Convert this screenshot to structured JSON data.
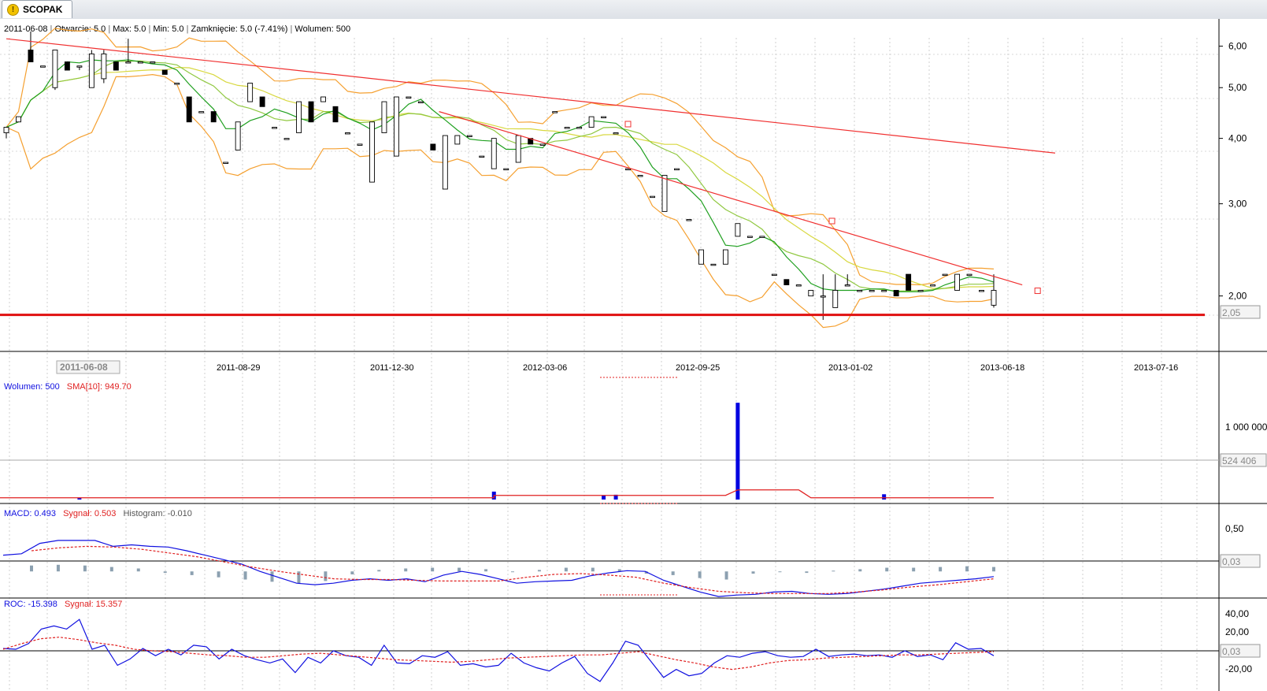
{
  "tab": {
    "label": "SCOPAK",
    "icon": "warning-icon"
  },
  "price_info": {
    "date": "2011-06-08",
    "open": "Otwarcie: 5.0",
    "max": "Max: 5.0",
    "min": "Min: 5.0",
    "close": "Zamknięcie: 5.0 (-7.41%)",
    "volume": "Wolumen: 500"
  },
  "volume_info": {
    "volume": "Wolumen: 500",
    "sma": "SMA[10]: 949.70"
  },
  "macd_info": {
    "macd": "MACD: 0.493",
    "signal": "Sygnał: 0.503",
    "hist": "Histogram: -0.010"
  },
  "roc_info": {
    "roc": "ROC: -15.398",
    "signal": "Sygnał: 15.357"
  },
  "x_labels": [
    "2011-06-08",
    "2011-08-29",
    "2011-12-30",
    "2012-03-06",
    "2012-09-25",
    "2013-01-02",
    "2013-06-18",
    "2013-07-16"
  ],
  "price_marker": "2,05",
  "volume_marker": "524 406",
  "macd_marker": "0,03",
  "roc_marker": "0,03",
  "colors": {
    "up": "#ffffff",
    "down": "#000000",
    "bollinger": "#f5a030",
    "ma_short": "#20a020",
    "ma_mid": "#90c840",
    "ma_long": "#d8d840",
    "trend": "#f03030",
    "support": "#e01010",
    "volume": "#0000e0",
    "macd": "#1010e0",
    "signal": "#e02020",
    "hist": "#8ca0b0"
  },
  "chart_data": [
    {
      "type": "candlestick",
      "title": "SCOPAK",
      "y_ticks": [
        "6,00",
        "5,00",
        "4,00",
        "3,00",
        "2,00"
      ],
      "ylim": [
        1.6,
        6.4
      ],
      "scale": "log",
      "candles": [
        [
          4.1,
          4.2,
          4.2,
          4.0
        ],
        [
          4.3,
          4.4,
          4.4,
          4.3
        ],
        [
          5.9,
          5.6,
          6.4,
          5.6
        ],
        [
          5.5,
          5.5,
          5.5,
          5.5
        ],
        [
          5.0,
          5.9,
          5.9,
          4.95
        ],
        [
          5.6,
          5.4,
          5.6,
          5.4
        ],
        [
          5.5,
          5.5,
          5.5,
          5.4
        ],
        [
          5.0,
          5.8,
          5.9,
          5.0
        ],
        [
          5.2,
          5.8,
          5.9,
          5.1
        ],
        [
          5.6,
          5.4,
          5.6,
          5.4
        ],
        [
          5.6,
          5.6,
          6.2,
          5.6
        ],
        [
          5.6,
          5.6,
          5.6,
          5.6
        ],
        [
          5.6,
          5.6,
          5.6,
          5.6
        ],
        [
          5.4,
          5.3,
          5.4,
          5.3
        ],
        [
          5.1,
          5.1,
          5.1,
          5.1
        ],
        [
          4.8,
          4.3,
          4.8,
          4.3
        ],
        [
          4.5,
          4.5,
          4.5,
          4.5
        ],
        [
          4.5,
          4.3,
          4.5,
          4.3
        ],
        [
          3.6,
          3.6,
          3.6,
          3.6
        ],
        [
          3.8,
          4.3,
          4.3,
          3.8
        ],
        [
          4.7,
          5.1,
          5.1,
          4.7
        ],
        [
          4.8,
          4.6,
          4.8,
          4.6
        ],
        [
          4.2,
          4.2,
          4.2,
          4.2
        ],
        [
          4.0,
          4.0,
          4.0,
          4.0
        ],
        [
          4.1,
          4.7,
          4.7,
          4.1
        ],
        [
          4.7,
          4.3,
          4.7,
          4.3
        ],
        [
          4.7,
          4.8,
          4.8,
          4.7
        ],
        [
          4.6,
          4.3,
          4.6,
          4.3
        ],
        [
          4.1,
          4.1,
          4.1,
          4.1
        ],
        [
          3.9,
          3.9,
          3.9,
          3.9
        ],
        [
          3.3,
          4.3,
          4.3,
          3.3
        ],
        [
          4.1,
          4.7,
          4.7,
          4.1
        ],
        [
          3.7,
          4.8,
          4.8,
          3.7
        ],
        [
          4.8,
          4.8,
          4.8,
          4.8
        ],
        [
          4.7,
          4.7,
          4.7,
          4.7
        ],
        [
          3.9,
          3.8,
          3.9,
          3.8
        ],
        [
          3.2,
          4.05,
          4.05,
          3.2
        ],
        [
          3.9,
          4.05,
          4.05,
          3.9
        ],
        [
          4.05,
          4.05,
          4.05,
          4.05
        ],
        [
          3.7,
          3.7,
          3.7,
          3.7
        ],
        [
          3.5,
          4.0,
          4.0,
          3.5
        ],
        [
          3.5,
          3.5,
          3.5,
          3.5
        ],
        [
          3.6,
          4.05,
          4.05,
          3.6
        ],
        [
          4.0,
          3.9,
          4.0,
          3.9
        ],
        [
          3.9,
          3.9,
          3.9,
          3.9
        ],
        [
          4.5,
          4.5,
          4.5,
          4.5
        ],
        [
          4.2,
          4.2,
          4.2,
          4.2
        ],
        [
          4.2,
          4.2,
          4.2,
          4.2
        ],
        [
          4.2,
          4.4,
          4.4,
          4.2
        ],
        [
          4.4,
          4.4,
          4.4,
          4.4
        ],
        [
          4.1,
          4.1,
          4.1,
          4.1
        ],
        [
          3.5,
          3.5,
          3.5,
          3.5
        ],
        [
          3.4,
          3.4,
          3.4,
          3.4
        ],
        [
          3.1,
          3.1,
          3.1,
          3.1
        ],
        [
          2.9,
          3.4,
          3.4,
          2.9
        ],
        [
          3.5,
          3.5,
          3.5,
          3.5
        ],
        [
          2.8,
          2.8,
          2.8,
          2.8
        ],
        [
          2.3,
          2.45,
          2.45,
          2.3
        ],
        [
          2.3,
          2.3,
          2.3,
          2.3
        ],
        [
          2.3,
          2.45,
          2.45,
          2.3
        ],
        [
          2.6,
          2.75,
          2.75,
          2.6
        ],
        [
          2.6,
          2.6,
          2.6,
          2.6
        ],
        [
          2.6,
          2.6,
          2.6,
          2.6
        ],
        [
          2.2,
          2.2,
          2.2,
          2.2
        ],
        [
          2.15,
          2.1,
          2.15,
          2.1
        ],
        [
          2.1,
          2.1,
          2.1,
          2.1
        ],
        [
          2.0,
          2.05,
          2.05,
          2.0
        ],
        [
          2.0,
          2.0,
          2.2,
          1.8
        ],
        [
          1.9,
          2.05,
          2.2,
          1.9
        ],
        [
          2.1,
          2.1,
          2.2,
          2.1
        ],
        [
          2.05,
          2.05,
          2.05,
          2.05
        ],
        [
          2.05,
          2.05,
          2.05,
          2.05
        ],
        [
          2.05,
          2.05,
          2.05,
          2.05
        ],
        [
          2.05,
          2.0,
          2.05,
          2.0
        ],
        [
          2.2,
          2.05,
          2.2,
          2.05
        ],
        [
          2.05,
          2.05,
          2.05,
          2.05
        ],
        [
          2.1,
          2.1,
          2.1,
          2.1
        ],
        [
          2.2,
          2.2,
          2.2,
          2.2
        ],
        [
          2.05,
          2.2,
          2.2,
          2.05
        ],
        [
          2.2,
          2.2,
          2.2,
          2.2
        ],
        [
          2.05,
          2.05,
          2.05,
          2.05
        ],
        [
          1.92,
          2.05,
          2.2,
          1.9
        ]
      ],
      "trend_lines": [
        [
          2011.43,
          6.2,
          2013.66,
          3.75
        ],
        [
          2012.35,
          4.5,
          2013.59,
          2.1
        ]
      ],
      "support_level": 1.84
    },
    {
      "type": "bar",
      "title": "Wolumen",
      "y_ticks": [
        "1 000 000"
      ],
      "ylim": [
        0,
        1200000
      ],
      "spike_values": [
        [
          6,
          15000
        ],
        [
          40,
          90000
        ],
        [
          49,
          45000
        ],
        [
          50,
          55000
        ],
        [
          60,
          1100000
        ],
        [
          72,
          60000
        ]
      ],
      "sma_high": 110000,
      "sma_low": 20000
    },
    {
      "type": "line",
      "title": "MACD",
      "y_ticks": [
        "0,50"
      ],
      "ylim": [
        -0.35,
        0.75
      ],
      "macd_points": [
        0.22,
        0.24,
        0.38,
        0.42,
        0.42,
        0.42,
        0.34,
        0.36,
        0.34,
        0.33,
        0.28,
        0.22,
        0.16,
        0.1,
        0.0,
        -0.08,
        -0.16,
        -0.18,
        -0.16,
        -0.12,
        -0.1,
        -0.12,
        -0.1,
        -0.14,
        -0.05,
        0.0,
        -0.04,
        -0.1,
        -0.16,
        -0.14,
        -0.13,
        -0.12,
        -0.06,
        -0.02,
        0.01,
        0.0,
        -0.12,
        -0.2,
        -0.28,
        -0.34,
        -0.32,
        -0.31,
        -0.28,
        -0.27,
        -0.3,
        -0.31,
        -0.3,
        -0.27,
        -0.24,
        -0.2,
        -0.16,
        -0.14,
        -0.12,
        -0.1,
        -0.07
      ],
      "signal_points": [
        0.28,
        0.32,
        0.34,
        0.33,
        0.3,
        0.25,
        0.2,
        0.13,
        0.06,
        0.0,
        -0.05,
        -0.1,
        -0.11,
        -0.11,
        -0.12,
        -0.13,
        -0.13,
        -0.13,
        -0.08,
        -0.04,
        -0.03,
        -0.05,
        -0.08,
        -0.16,
        -0.22,
        -0.27,
        -0.29,
        -0.3,
        -0.3,
        -0.3,
        -0.28,
        -0.25,
        -0.21,
        -0.18,
        -0.14,
        -0.1
      ],
      "hist_values": [
        0.08,
        0.09,
        0.08,
        0.06,
        0.04,
        -0.02,
        -0.05,
        -0.08,
        -0.11,
        -0.14,
        -0.16,
        -0.13,
        -0.04,
        0.02,
        0.04,
        0.05,
        0.05,
        0.03,
        0.0,
        0.02,
        0.05,
        0.05,
        0.03,
        -0.03,
        -0.05,
        -0.09,
        -0.11,
        -0.03,
        0.0,
        -0.02,
        0.01,
        0.03,
        0.05,
        0.05,
        0.06,
        0.07,
        0.06
      ]
    },
    {
      "type": "line",
      "title": "ROC",
      "y_ticks": [
        "40,00",
        "20,00",
        "0,00",
        "-20,00"
      ],
      "ylim": [
        -40,
        50
      ],
      "roc_points": [
        6,
        5,
        12,
        30,
        34,
        30,
        42,
        5,
        10,
        -15,
        -7,
        6,
        -3,
        5,
        -2,
        10,
        8,
        -7,
        5,
        -3,
        -8,
        -12,
        -7,
        -24,
        -5,
        -12,
        3,
        -3,
        -5,
        -15,
        10,
        -12,
        -13,
        -3,
        -5,
        2,
        -15,
        -13,
        -17,
        -15,
        0,
        -12,
        -18,
        -22,
        -12,
        -4,
        -25,
        -35,
        -12,
        15,
        10,
        -10,
        -30,
        -20,
        -28,
        -25,
        -12,
        -3,
        -5,
        0,
        2,
        -3,
        -5,
        -4,
        5,
        -4,
        -2,
        -1,
        -3,
        -2,
        -5,
        3,
        -4,
        -2,
        -8,
        13,
        5,
        6,
        -3
      ],
      "signal_points": [
        5,
        12,
        18,
        20,
        17,
        13,
        10,
        5,
        3,
        2,
        0,
        -2,
        -3,
        -5,
        -5,
        -3,
        -1,
        0,
        -2,
        -4,
        -6,
        -8,
        -9,
        -10,
        -11,
        -10,
        -8,
        -6,
        -5,
        -4,
        -3,
        -2,
        -2,
        0,
        2,
        -3,
        -8,
        -12,
        -17,
        -20,
        -17,
        -12,
        -9,
        -8,
        -6,
        -5,
        -4,
        -3,
        -2,
        -2,
        -1,
        0,
        1,
        2
      ]
    }
  ]
}
